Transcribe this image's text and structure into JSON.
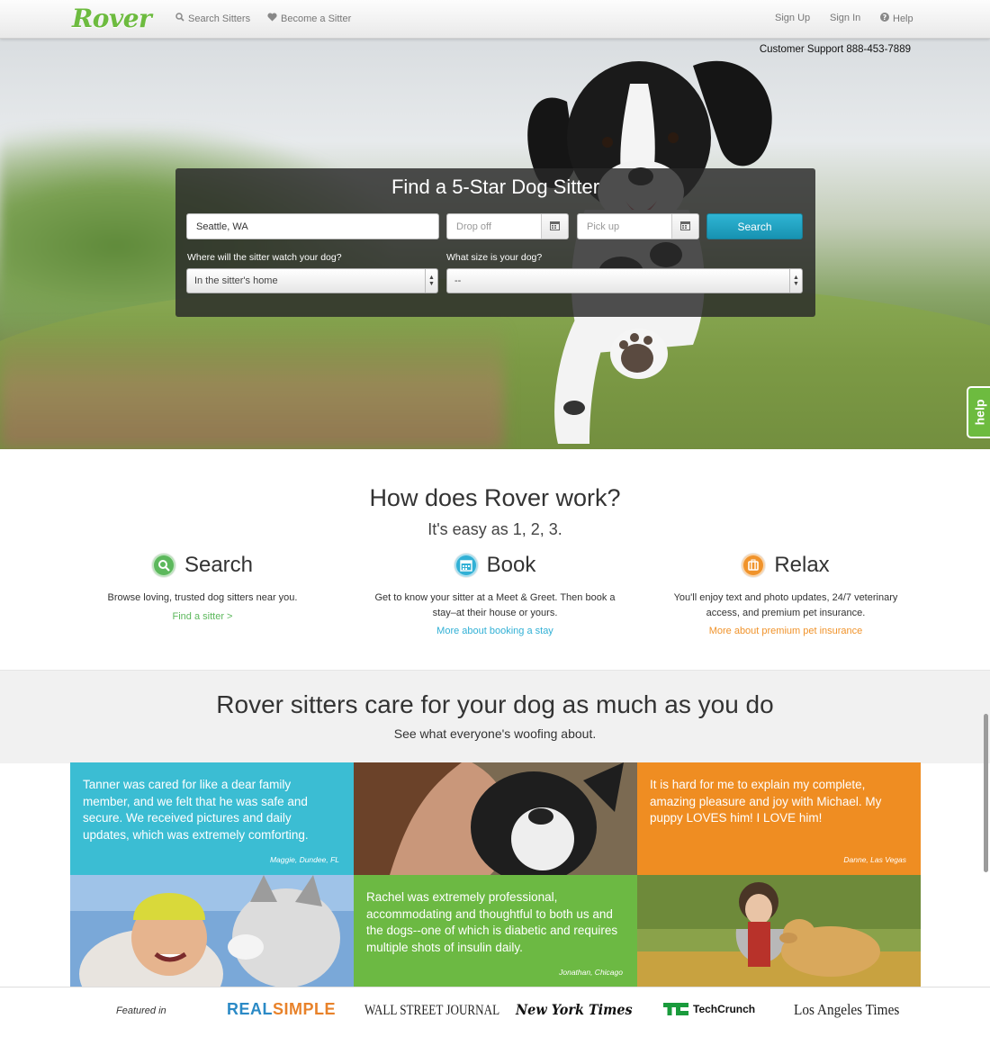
{
  "nav": {
    "logo": "Rover",
    "search_sitters": "Search Sitters",
    "become_sitter": "Become a Sitter",
    "sign_up": "Sign Up",
    "sign_in": "Sign In",
    "help": "Help"
  },
  "hero": {
    "support": "Customer Support 888-453-7889",
    "help_tab": "help",
    "search": {
      "title": "Find a 5-Star Dog Sitter",
      "location_value": "Seattle, WA",
      "dropoff_placeholder": "Drop off",
      "pickup_placeholder": "Pick up",
      "search_button": "Search",
      "where_label": "Where will the sitter watch your dog?",
      "where_value": "In the sitter's home",
      "size_label": "What size is your dog?",
      "size_value": "--"
    }
  },
  "how": {
    "title": "How does Rover work?",
    "subtitle": "It's easy as 1, 2, 3.",
    "steps": [
      {
        "title": "Search",
        "desc": "Browse loving, trusted dog sitters near you.",
        "link": "Find a sitter >",
        "color": "#5cb85c",
        "icon": "search-icon"
      },
      {
        "title": "Book",
        "desc": "Get to know your sitter at a Meet & Greet. Then book a stay–at their house or yours.",
        "link": "More about booking a stay",
        "color": "#31b0d5",
        "icon": "calendar-icon"
      },
      {
        "title": "Relax",
        "desc": "You'll enjoy text and photo updates, 24/7 veterinary access, and premium pet insurance.",
        "link": "More about premium pet insurance",
        "color": "#f0932b",
        "icon": "suitcase-icon"
      }
    ]
  },
  "testimonials": {
    "title": "Rover sitters care for your dog as much as you do",
    "subtitle": "See what everyone's woofing about.",
    "quotes": [
      {
        "text": "Tanner was cared for like a dear family member, and we felt that he was safe and secure. We received pictures and daily updates, which was extremely comforting.",
        "author": "Maggie, Dundee, FL",
        "color": "#3bbdd3"
      },
      {
        "text": "It is hard for me to explain my complete, amazing pleasure and joy with Michael. My puppy LOVES him! I LOVE him!",
        "author": "Danne, Las Vegas",
        "color": "#ef8d22"
      },
      {
        "text": "Rachel was extremely professional, accommodating and thoughtful to both us and the dogs--one of which is diabetic and requires multiple shots of insulin daily.",
        "author": "Jonathan, Chicago",
        "color": "#6cb943"
      }
    ]
  },
  "featured": {
    "label": "Featured in",
    "publications": [
      "REAL SIMPLE",
      "WALL STREET JOURNAL",
      "New York Times",
      "TechCrunch",
      "Los Angeles Times"
    ]
  },
  "colors": {
    "brand_green": "#6dbb3f",
    "search_blue": "#1fa5c6"
  }
}
